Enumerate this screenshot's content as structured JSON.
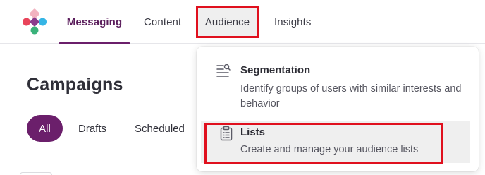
{
  "nav": {
    "logo_icon": "brand-logo-icon",
    "tabs": [
      {
        "label": "Messaging",
        "active": true
      },
      {
        "label": "Content",
        "active": false
      },
      {
        "label": "Audience",
        "active": false,
        "highlighted": true
      },
      {
        "label": "Insights",
        "active": false
      }
    ]
  },
  "page": {
    "title": "Campaigns",
    "filters": [
      {
        "label": "All",
        "selected": true
      },
      {
        "label": "Drafts",
        "selected": false
      },
      {
        "label": "Scheduled",
        "selected": false
      }
    ]
  },
  "audience_menu": {
    "items": [
      {
        "icon": "segmentation-icon",
        "title": "Segmentation",
        "description": "Identify groups of users with similar interests and behavior"
      },
      {
        "icon": "clipboard-list-icon",
        "title": "Lists",
        "description": "Create and manage your audience lists",
        "hovered": true,
        "highlighted": true
      }
    ]
  },
  "colors": {
    "accent": "#6b1f6b",
    "highlight_border": "#e0101e",
    "hover_bg": "#efefef",
    "logo": [
      "#e9445a",
      "#8a3c8c",
      "#35b5e5",
      "#3ab27a",
      "#f2b3c0"
    ]
  }
}
